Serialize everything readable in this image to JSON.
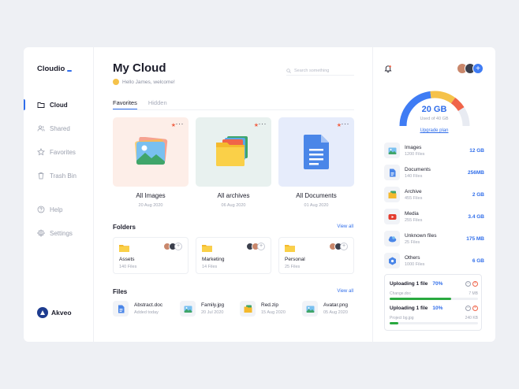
{
  "app": {
    "name": "Cloudio",
    "brand": "Akveo",
    "accent": "#2f6dea"
  },
  "nav": [
    {
      "label": "Cloud",
      "icon": "folder-icon",
      "active": true
    },
    {
      "label": "Shared",
      "icon": "users-icon",
      "active": false
    },
    {
      "label": "Favorites",
      "icon": "star-icon",
      "active": false
    },
    {
      "label": "Trash Bin",
      "icon": "trash-icon",
      "active": false
    },
    {
      "label": "Help",
      "icon": "help-icon",
      "active": false
    },
    {
      "label": "Settings",
      "icon": "settings-icon",
      "active": false
    }
  ],
  "main": {
    "title": "My Cloud",
    "welcome": "Hello James, welcome!",
    "search_placeholder": "Search something",
    "tabs": [
      {
        "label": "Favorites",
        "active": true
      },
      {
        "label": "Hidden",
        "active": false
      }
    ],
    "favorites": [
      {
        "name": "All Images",
        "date": "20 Aug 2020",
        "icon": "image-icon",
        "bg": "#fdeee8"
      },
      {
        "name": "All archives",
        "date": "06 Aug 2020",
        "icon": "archive-folder-icon",
        "bg": "#e8f1ef"
      },
      {
        "name": "All Documents",
        "date": "01 Aug 2020",
        "icon": "document-icon",
        "bg": "#e6ecfb"
      }
    ],
    "folders_title": "Folders",
    "folders_view_all": "View all",
    "folders": [
      {
        "name": "Assets",
        "count": "140 Files"
      },
      {
        "name": "Marketing",
        "count": "14 Files"
      },
      {
        "name": "Personal",
        "count": "25 Files"
      }
    ],
    "files_title": "Files",
    "files_view_all": "View all",
    "files": [
      {
        "name": "Abstract.doc",
        "date": "Added today",
        "icon": "doc-file-icon"
      },
      {
        "name": "Family.jpg",
        "date": "20 Jul 2020",
        "icon": "image-file-icon"
      },
      {
        "name": "Red.zip",
        "date": "15 Aug 2020",
        "icon": "zip-file-icon"
      },
      {
        "name": "Avatar.png",
        "date": "05 Aug 2020",
        "icon": "image-file-icon"
      }
    ]
  },
  "storage": {
    "used": "20 GB",
    "used_of": "Used of 40 GB",
    "used_fraction": 0.5,
    "gauge_segments": [
      {
        "color": "#3f7cf4",
        "share": 0.46
      },
      {
        "color": "#f5c24a",
        "share": 0.24
      },
      {
        "color": "#f06449",
        "share": 0.12
      },
      {
        "color": "#e8ebf2",
        "share": 0.18
      }
    ],
    "upgrade": "Upgrade plan",
    "categories": [
      {
        "name": "Images",
        "count": "1200 Files",
        "size": "12 GB",
        "icon": "images-icon"
      },
      {
        "name": "Documents",
        "count": "140 Files",
        "size": "256MB",
        "icon": "documents-icon"
      },
      {
        "name": "Archive",
        "count": "455 Files",
        "size": "2 GB",
        "icon": "archive-icon"
      },
      {
        "name": "Media",
        "count": "255 Files",
        "size": "3.4 GB",
        "icon": "media-icon"
      },
      {
        "name": "Unknown files",
        "count": "25 Files",
        "size": "175 MB",
        "icon": "unknown-file-icon"
      },
      {
        "name": "Others",
        "count": "1000 Files",
        "size": "6 GB",
        "icon": "others-icon"
      }
    ],
    "uploads": [
      {
        "title": "Uploading 1 file",
        "percent": "70%",
        "file": "Change.doc",
        "size": "7 MB",
        "progress": 0.7
      },
      {
        "title": "Uploading 1 file",
        "percent": "10%",
        "file": "Project bg.jpg",
        "size": "240 KB",
        "progress": 0.1
      }
    ]
  }
}
